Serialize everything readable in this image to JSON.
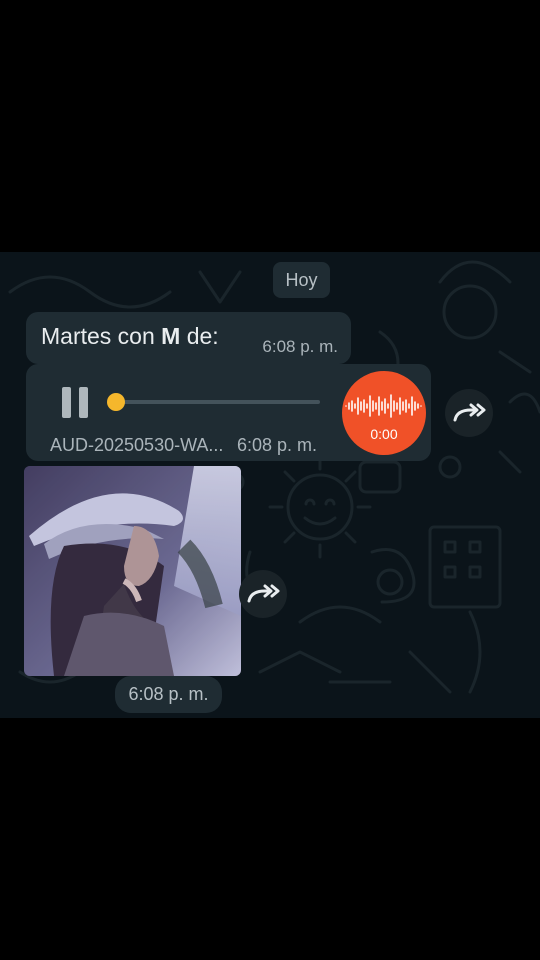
{
  "chat": {
    "date_label": "Hoy",
    "text_message": {
      "prefix": "Martes con ",
      "bold": "M",
      "suffix": " de:",
      "time": "6:08 p. m."
    },
    "audio_message": {
      "file_name": "AUD-20250530-WA...",
      "time": "6:08 p. m.",
      "duration": "0:00",
      "progress": 0.03,
      "state": "playing",
      "accent_color": "#f05128",
      "progress_color": "#f5b72c"
    },
    "photo_message": {
      "time": "6:08 p. m."
    }
  },
  "icons": {
    "pause": "pause-icon",
    "forward": "forward-icon",
    "waveform": "waveform-icon"
  }
}
